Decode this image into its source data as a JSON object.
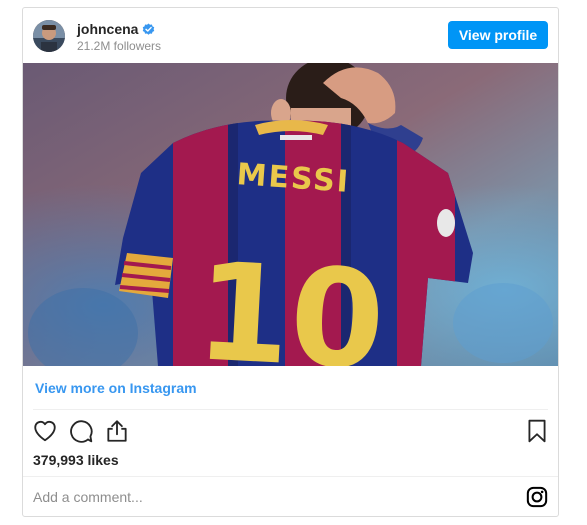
{
  "header": {
    "username": "johncena",
    "followers": "21.2M followers",
    "view_profile_label": "View profile",
    "avatar_icon": "avatar-photo",
    "verified_icon": "verified-badge-icon"
  },
  "post": {
    "image_description_icon": "post-photo",
    "jersey_name": "MESSI",
    "jersey_number": "10"
  },
  "links": {
    "view_more": "View more on Instagram"
  },
  "actions": {
    "like_icon": "heart-icon",
    "comment_icon": "comment-icon",
    "share_icon": "share-icon",
    "save_icon": "bookmark-icon"
  },
  "likes": "379,993 likes",
  "comment": {
    "placeholder": "Add a comment..."
  },
  "colors": {
    "accent": "#0095f6",
    "link": "#3897f0",
    "text": "#262626",
    "muted": "#8e8e8e",
    "border": "#dbdbdb"
  }
}
